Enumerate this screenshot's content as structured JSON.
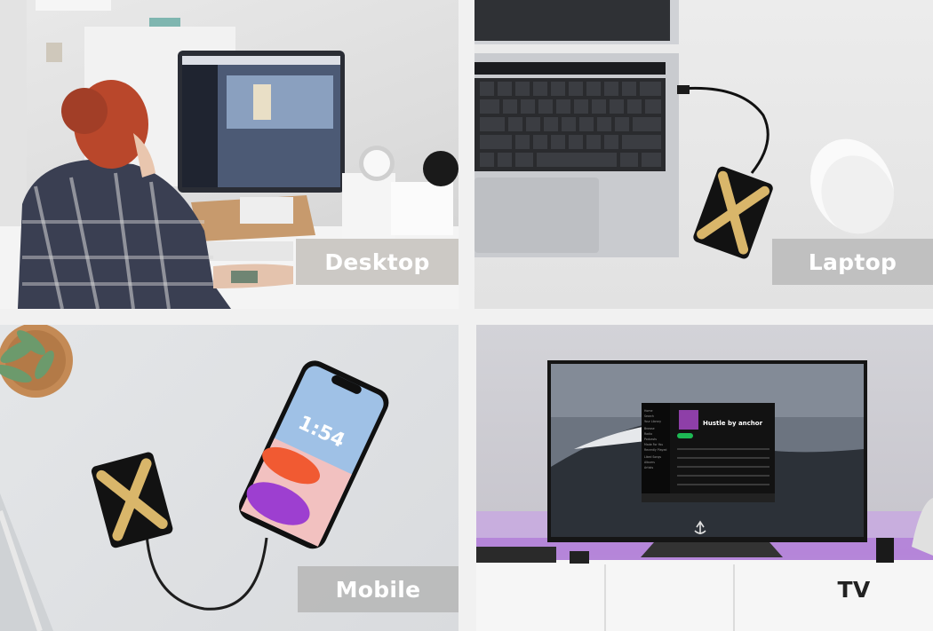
{
  "tiles": {
    "desktop": {
      "label": "Desktop"
    },
    "laptop": {
      "label": "Laptop"
    },
    "mobile": {
      "label": "Mobile",
      "phone_time": "1:54"
    },
    "tv": {
      "label": "TV",
      "screen_title": "Hustle by anchor",
      "sidebar_items": [
        "Home",
        "Search",
        "Your Library",
        "Browse",
        "Radio",
        "Podcasts",
        "Made For You",
        "Recently Played",
        "Liked Songs",
        "Albums",
        "Artists"
      ]
    }
  }
}
